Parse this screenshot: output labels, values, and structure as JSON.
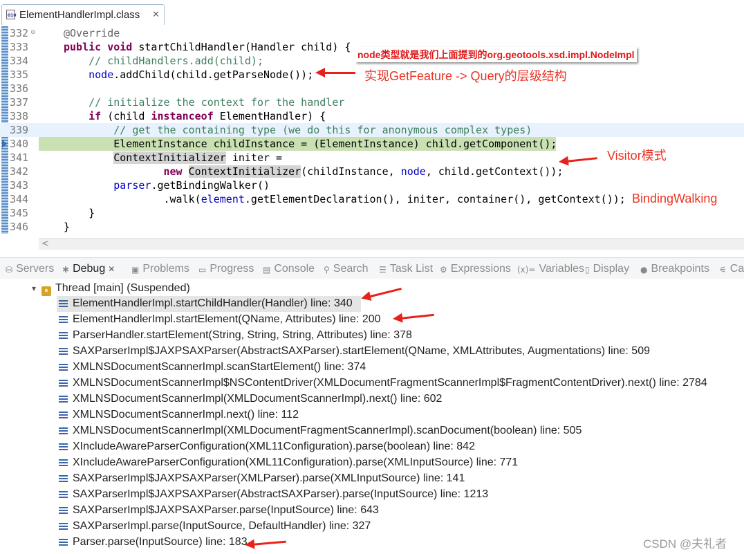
{
  "editor": {
    "tab_title": "ElementHandlerImpl.class",
    "file_icon_text": "010",
    "tab_close": "✕",
    "lines": [
      {
        "num": "332",
        "html": "<span class=\"ann\">@Override</span>"
      },
      {
        "num": "333",
        "html": "<span class=\"kw\">public</span> <span class=\"kw\">void</span> startChildHandler(Handler child) {"
      },
      {
        "num": "334",
        "html": "    <span class=\"cm\">// childHandlers.add(child);</span>"
      },
      {
        "num": "335",
        "html": "    <span class=\"fld\">node</span>.addChild(child.getParseNode());"
      },
      {
        "num": "336",
        "html": ""
      },
      {
        "num": "337",
        "html": "    <span class=\"cm\">// initialize the context for the handler</span>"
      },
      {
        "num": "338",
        "html": "    <span class=\"kw\">if</span> (child <span class=\"kw\">instanceof</span> ElementHandler) {"
      },
      {
        "num": "339",
        "html": "        <span class=\"cm\">// get the containing type (we do this for anonymous complex types)</span>"
      },
      {
        "num": "340",
        "html": "        ElementInstance childInstance = (ElementInstance) child.getComponent();"
      },
      {
        "num": "341",
        "html": "        <span class=\"occ\">ContextInitializer</span> initer ="
      },
      {
        "num": "342",
        "html": "                <span class=\"kw\">new</span> <span class=\"occ\">ContextInitializer</span>(childInstance, <span class=\"fld\">node</span>, child.getContext());"
      },
      {
        "num": "343",
        "html": "        <span class=\"fld\">parser</span>.getBindingWalker()"
      },
      {
        "num": "344",
        "html": "                .walk(<span class=\"fld\">element</span>.getElementDeclaration(), initer, container(), getContext());"
      },
      {
        "num": "345",
        "html": "    }"
      },
      {
        "num": "346",
        "html": "}"
      }
    ],
    "scroll_left": "<"
  },
  "annotations": {
    "node_note": "node类型就是我们上面提到的org.geotools.xsd.impl.NodeImpl",
    "getfeature_note": "实现GetFeature -> Query的层级结构",
    "visitor_note": "Visitor模式",
    "bindingwalking_note": "BindingWalking"
  },
  "views": {
    "tabs": [
      {
        "label": "Servers",
        "icon": "⛁"
      },
      {
        "label": "Debug",
        "icon": "✱"
      },
      {
        "label": "Problems",
        "icon": "▣"
      },
      {
        "label": "Progress",
        "icon": "▭"
      },
      {
        "label": "Console",
        "icon": "▤"
      },
      {
        "label": "Search",
        "icon": "⚲"
      },
      {
        "label": "Task List",
        "icon": "☰"
      },
      {
        "label": "Expressions",
        "icon": "⚙"
      },
      {
        "label": "Variables",
        "icon": "(x)="
      },
      {
        "label": "Display",
        "icon": "▯"
      },
      {
        "label": "Breakpoints",
        "icon": "●"
      },
      {
        "label": "Ca",
        "icon": "⚟"
      }
    ],
    "active_close": "✕"
  },
  "debug": {
    "thread_chevron": "▾",
    "thread_label": "Thread [main] (Suspended)",
    "frames": [
      "ElementHandlerImpl.startChildHandler(Handler) line: 340",
      "ElementHandlerImpl.startElement(QName, Attributes) line: 200",
      "ParserHandler.startElement(String, String, String, Attributes) line: 378",
      "SAXParserImpl$JAXPSAXParser(AbstractSAXParser).startElement(QName, XMLAttributes, Augmentations) line: 509",
      "XMLNSDocumentScannerImpl.scanStartElement() line: 374",
      "XMLNSDocumentScannerImpl$NSContentDriver(XMLDocumentFragmentScannerImpl$FragmentContentDriver).next() line: 2784",
      "XMLNSDocumentScannerImpl(XMLDocumentScannerImpl).next() line: 602",
      "XMLNSDocumentScannerImpl.next() line: 112",
      "XMLNSDocumentScannerImpl(XMLDocumentFragmentScannerImpl).scanDocument(boolean) line: 505",
      "XIncludeAwareParserConfiguration(XML11Configuration).parse(boolean) line: 842",
      "XIncludeAwareParserConfiguration(XML11Configuration).parse(XMLInputSource) line: 771",
      "SAXParserImpl$JAXPSAXParser(XMLParser).parse(XMLInputSource) line: 141",
      "SAXParserImpl$JAXPSAXParser(AbstractSAXParser).parse(InputSource) line: 1213",
      "SAXParserImpl$JAXPSAXParser.parse(InputSource) line: 643",
      "SAXParserImpl.parse(InputSource, DefaultHandler) line: 327",
      "Parser.parse(InputSource) line: 183"
    ]
  },
  "watermark": "CSDN @夫礼者",
  "colors": {
    "keyword": "#7f0055",
    "comment": "#3f7f5f",
    "field": "#0000c0",
    "annotation_red": "#ea3323"
  }
}
